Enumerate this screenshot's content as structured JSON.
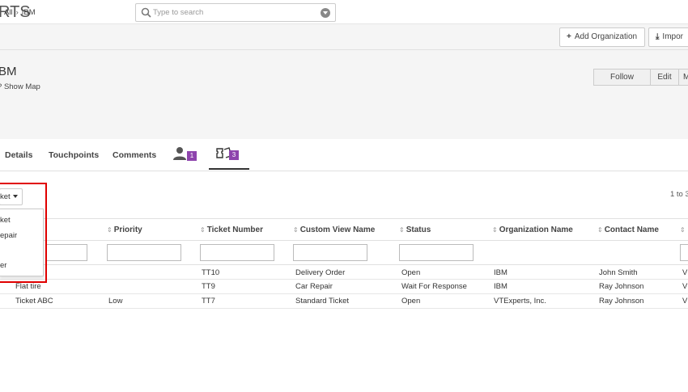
{
  "topbar": {
    "logo_text": "RTS",
    "search_placeholder": "Type to search"
  },
  "breadcrumb": {
    "root": "All",
    "current": "IBM"
  },
  "actions": {
    "add_organization": "Add Organization",
    "import": "Impor"
  },
  "record": {
    "title": "BM",
    "show_map": "Show Map",
    "follow": "Follow",
    "edit": "Edit",
    "more": "M"
  },
  "tabs": {
    "details": "Details",
    "touchpoints": "Touchpoints",
    "comments": "Comments",
    "contacts_count": "1",
    "tickets_count": "3"
  },
  "list": {
    "select_label": "ket",
    "paging": "1 to 3",
    "dropdown_items": [
      "ket",
      "epair",
      "",
      "er"
    ],
    "columns": [
      "Priority",
      "Ticket Number",
      "Custom View Name",
      "Status",
      "Organization Name",
      "Contact Name"
    ],
    "rows": [
      {
        "title": "",
        "priority": "",
        "ticket_number": "TT10",
        "custom_view": "Delivery Order",
        "status": "Open",
        "organization": "IBM",
        "contact": "John Smith",
        "extra": "V"
      },
      {
        "title": "Flat tire",
        "priority": "",
        "ticket_number": "TT9",
        "custom_view": "Car Repair",
        "status": "Wait For Response",
        "organization": "IBM",
        "contact": "Ray Johnson",
        "extra": "V"
      },
      {
        "title": "Ticket ABC",
        "priority": "Low",
        "ticket_number": "TT7",
        "custom_view": "Standard Ticket",
        "status": "Open",
        "organization": "VTExperts, Inc.",
        "contact": "Ray Johnson",
        "extra": "V"
      }
    ]
  },
  "colors": {
    "badge": "#8e44ad",
    "highlight": "#e00000"
  }
}
